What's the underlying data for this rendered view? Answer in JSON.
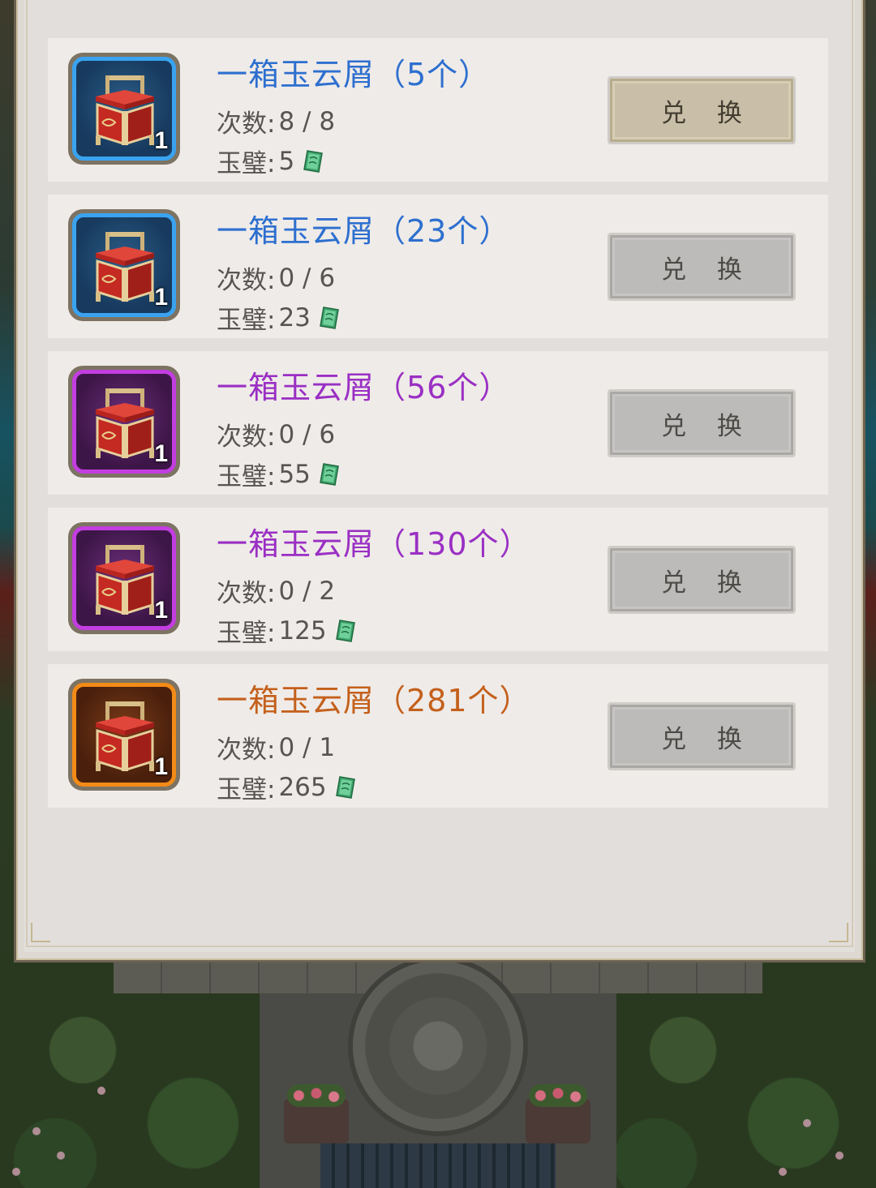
{
  "exchange_button_label": "兑 换",
  "times_label": "次数:",
  "cost_label": "玉璧:",
  "icon_quantity": "1",
  "items": [
    {
      "title": "一箱玉云屑（5个）",
      "rarity": "blue",
      "times": "8 / 8",
      "cost": "5",
      "button_state": "active",
      "rarity_color": "#2d6fcf"
    },
    {
      "title": "一箱玉云屑（23个）",
      "rarity": "blue",
      "times": "0 / 6",
      "cost": "23",
      "button_state": "inactive",
      "rarity_color": "#2d6fcf"
    },
    {
      "title": "一箱玉云屑（56个）",
      "rarity": "purple",
      "times": "0 / 6",
      "cost": "55",
      "button_state": "inactive",
      "rarity_color": "#9a2fc4"
    },
    {
      "title": "一箱玉云屑（130个）",
      "rarity": "purple",
      "times": "0 / 2",
      "cost": "125",
      "button_state": "inactive",
      "rarity_color": "#9a2fc4"
    },
    {
      "title": "一箱玉云屑（281个）",
      "rarity": "orange",
      "times": "0 / 1",
      "cost": "265",
      "button_state": "inactive",
      "rarity_color": "#c4601c"
    }
  ],
  "icons": {
    "chest": "treasure-chest-icon",
    "currency": "jade-currency-icon"
  }
}
